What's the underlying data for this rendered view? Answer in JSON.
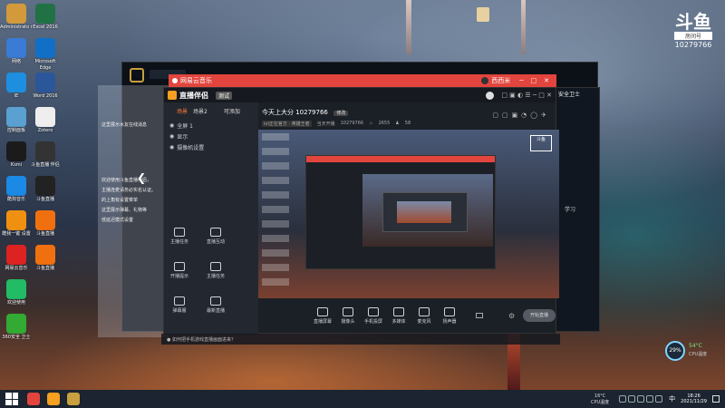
{
  "desktop": {
    "icons_left": [
      {
        "label": "Administrato r",
        "color": "#d29a3a"
      },
      {
        "label": "网络",
        "color": "#3a7bd5"
      },
      {
        "label": "IE",
        "color": "#1e8fe0"
      },
      {
        "label": "控制面板",
        "color": "#5aa0d0"
      },
      {
        "label": "Ksmi",
        "color": "#1b1b1b"
      },
      {
        "label": "酷狗音乐",
        "color": "#1a8ae6"
      },
      {
        "label": "酷我一键 设置",
        "color": "#f09010"
      },
      {
        "label": "网易云音乐",
        "color": "#d22"
      },
      {
        "label": "欢迎使用",
        "color": "#2b6"
      },
      {
        "label": "360安全 卫士",
        "color": "#3a3"
      }
    ],
    "icons_right": [
      {
        "label": "Excel 2016",
        "color": "#207245"
      },
      {
        "label": "Microsoft Edge",
        "color": "#1170c6"
      },
      {
        "label": "Word 2016",
        "color": "#2b579a"
      },
      {
        "label": "Zotero",
        "color": "#eee"
      },
      {
        "label": "斗鱼直播 伴侣",
        "color": "#333"
      },
      {
        "label": "斗鱼直播",
        "color": "#222"
      },
      {
        "label": "斗鱼直播",
        "color": "#f07010"
      },
      {
        "label": "斗鱼直播",
        "color": "#f07010"
      },
      {
        "label": "",
        "color": "transparent"
      },
      {
        "label": "",
        "color": "transparent"
      }
    ]
  },
  "brand": {
    "mark": "斗鱼",
    "tag": "房间号",
    "room": "10279766"
  },
  "music_window": {
    "title": "网易云音乐",
    "user": "西西米"
  },
  "stream_window": {
    "app_title": "直播伴侣",
    "badge": "测试",
    "room_title": "今天上大分 10279766",
    "edit_label": "修改",
    "category": "lol正在官方 · 英雄王者",
    "status": "当天开播",
    "room_num": "10279766",
    "heat": "2655",
    "fans": "58",
    "tabs": [
      "场景",
      "场景2",
      "可添加"
    ],
    "sources": [
      {
        "name": "全屏 1"
      },
      {
        "name": "显示"
      },
      {
        "name": "摄像机设置"
      }
    ],
    "side_tools": [
      "主播任务",
      "直播互动",
      "开播提示",
      "主播任务",
      "弹幕服",
      "最新直播"
    ],
    "bottom_tools": [
      "直播屏幕",
      "摄像头",
      "手机投屏",
      "多媒体",
      "麦克风",
      "扬声器"
    ],
    "start_button": "开始直播",
    "left_messages": [
      "这里展示水友在线消息",
      "欢迎使用斗鱼直播伴侣，",
      "主播连麦请务必实名认证。",
      "的上角有设置菜单",
      "这里展示弹幕、礼物等",
      "低延迟模式设置"
    ],
    "footer_hint": "如何把手机游戏直播画面进来？"
  },
  "right_window": {
    "title": "安全卫士",
    "lines": [
      "手机",
      "",
      "",
      "",
      "",
      "",
      "学习"
    ]
  },
  "widget": {
    "percent": "29%",
    "temp": "54°C",
    "temp_label": "CPU温度"
  },
  "taskbar": {
    "weather_temp": "16°C",
    "weather_label": "CPU温度",
    "time": "18:26",
    "date": "2021/11/29",
    "ime": "中"
  }
}
